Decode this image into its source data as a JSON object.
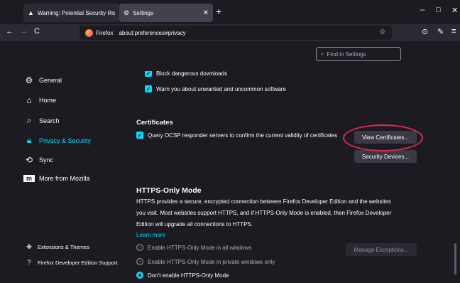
{
  "tabs": [
    {
      "label": "Warning: Potential Security Risk X",
      "icon": "warning-icon"
    },
    {
      "label": "Settings",
      "icon": "gear-icon"
    }
  ],
  "window_controls": {
    "minimize": "–",
    "maximize": "□",
    "close": "✕"
  },
  "nav": {
    "back": "←",
    "forward": "→",
    "reload": "C",
    "url_brand": "Firefox",
    "url": "about:preferences#privacy",
    "bookmark": "☆",
    "pocket": "⊙",
    "tools": "✎",
    "menu": "≡"
  },
  "sidebar": {
    "items": [
      {
        "label": "General",
        "icon": "gear-icon"
      },
      {
        "label": "Home",
        "icon": "home-icon"
      },
      {
        "label": "Search",
        "icon": "search-icon"
      },
      {
        "label": "Privacy & Security",
        "icon": "lock-icon",
        "active": true
      },
      {
        "label": "Sync",
        "icon": "sync-icon"
      },
      {
        "label": "More from Mozilla",
        "icon": "mozilla-icon"
      }
    ],
    "footer": [
      {
        "label": "Extensions & Themes",
        "icon": "puzzle-icon"
      },
      {
        "label": "Firefox Developer Edition Support",
        "icon": "help-icon"
      }
    ]
  },
  "search": {
    "placeholder": "Find in Settings"
  },
  "security": {
    "block_dangerous": "Block dangerous downloads",
    "warn_unwanted": "Warn you about unwanted and uncommon software"
  },
  "certificates": {
    "heading": "Certificates",
    "ocsp": "Query OCSP responder servers to confirm the current validity of certificates",
    "view_button": "View Certificates...",
    "devices_button": "Security Devices..."
  },
  "https": {
    "heading": "HTTPS-Only Mode",
    "line1": "HTTPS provides a secure, encrypted connection between Firefox Developer Edition and the websites",
    "line2": "you visit. Most websites support HTTPS, and if HTTPS-Only Mode is enabled, then Firefox Developer",
    "line3": "Edition will upgrade all connections to HTTPS.",
    "learn_more": "Learn more",
    "manage_button": "Manage Exceptions...",
    "options": [
      {
        "label": "Enable HTTPS-Only Mode in all windows",
        "selected": false
      },
      {
        "label": "Enable HTTPS-Only Mode in private windows only",
        "selected": false
      },
      {
        "label": "Don't enable HTTPS-Only Mode",
        "selected": true
      }
    ]
  },
  "colors": {
    "accent": "#00ddff",
    "annotation": "#e22850",
    "background": "#1c1b22"
  }
}
